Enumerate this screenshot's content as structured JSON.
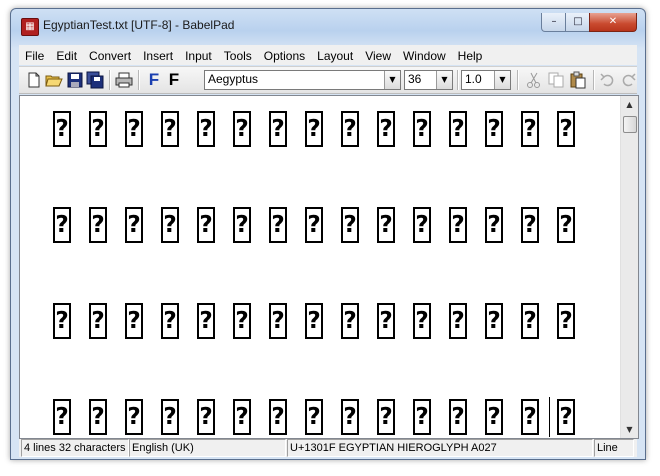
{
  "window": {
    "title": "EgyptianTest.txt [UTF-8] - BabelPad",
    "minimize_glyph": "–",
    "maximize_glyph": "□",
    "close_glyph": "✕"
  },
  "menu": [
    "File",
    "Edit",
    "Convert",
    "Insert",
    "Input",
    "Tools",
    "Options",
    "Layout",
    "View",
    "Window",
    "Help"
  ],
  "toolbar": {
    "font_name": "Aegyptus",
    "font_size": "36",
    "line_spacing": "1.0",
    "bold_f_label": "F",
    "plain_f_label": "F"
  },
  "document": {
    "missing_glyph": "?",
    "lines": [
      [
        "?",
        "?",
        "?",
        "?",
        "?",
        "?",
        "?",
        "?",
        "?",
        "?",
        "?",
        "?",
        "?",
        "?",
        "?"
      ],
      [
        "?",
        "?",
        "?",
        "?",
        "?",
        "?",
        "?",
        "?",
        "?",
        "?",
        "?",
        "?",
        "?",
        "?",
        "?"
      ],
      [
        "?",
        "?",
        "?",
        "?",
        "?",
        "?",
        "?",
        "?",
        "?",
        "?",
        "?",
        "?",
        "?",
        "?",
        "?"
      ],
      [
        "?",
        "?",
        "?",
        "?",
        "?",
        "?",
        "?",
        "?",
        "?",
        "?",
        "?",
        "?",
        "?",
        "?",
        "?"
      ]
    ]
  },
  "statusbar": {
    "counts": "4 lines 32 characters",
    "language": "English (UK)",
    "char_info": "U+1301F EGYPTIAN HIEROGLYPH A027",
    "mode": "Line"
  },
  "colors": {
    "title_gradient_top": "#cfe0f4",
    "close_button": "#c94a2f",
    "menu_background": "#f0f0f0",
    "text_color": "#000000"
  }
}
